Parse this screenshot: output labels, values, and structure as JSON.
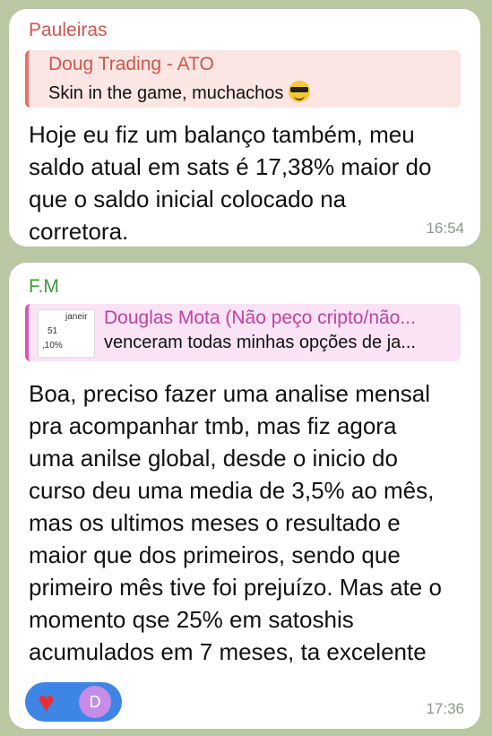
{
  "messages": [
    {
      "sender": "Pauleiras",
      "reply": {
        "name": "Doug Trading - ATO",
        "text": "Skin in the game, muchachos",
        "emoji": "sunglasses-emoji"
      },
      "lines": [
        "Hoje eu fiz um balanço também, meu",
        "saldo atual em sats é 17,38% maior do",
        "que o saldo inicial colocado na",
        "corretora."
      ],
      "time": "16:54"
    },
    {
      "sender": "F.M",
      "reply": {
        "name": "Douglas Mota (Não peço cripto/não...",
        "text": "venceram todas minhas opções de ja...",
        "thumbnail": {
          "top": "janeir",
          "mid": "51",
          "bottom": ",10%"
        }
      },
      "lines": [
        "Boa, preciso fazer uma analise mensal",
        "pra acompanhar tmb, mas fiz agora",
        "uma anilse global, desde o inicio do",
        "curso deu uma media de 3,5% ao mês,",
        "mas os ultimos meses o resultado e",
        "maior que dos primeiros, sendo que",
        "primeiro mês tive foi prejuízo. Mas ate o",
        "momento qse 25% em satoshis",
        "acumulados em 7 meses, ta excelente"
      ],
      "reactions": {
        "emoji": "heart-icon",
        "avatar_letter": "D"
      },
      "time": "17:36"
    }
  ],
  "colors": {
    "sender1": "#d0564a",
    "sender2": "#3f9a3a",
    "reply2_accent": "#c241a4",
    "reaction_pill": "#3d86e6"
  }
}
